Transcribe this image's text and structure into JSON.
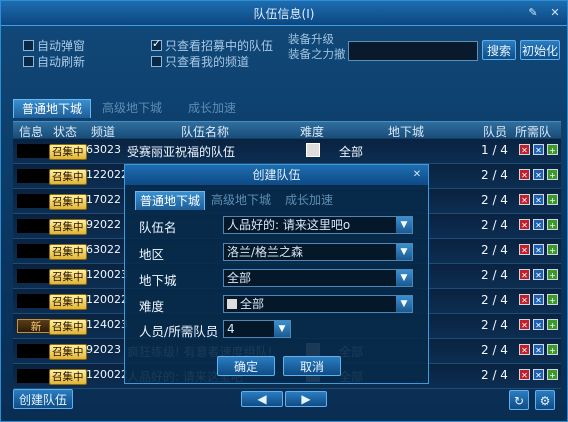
{
  "window": {
    "title": "队伍信息(I)"
  },
  "filters": {
    "auto_popup": "自动弹窗",
    "auto_refresh": "自动刷新",
    "only_recruiting": "只查看招募中的队伍",
    "only_my_channel": "只查看我的频道",
    "equip_upgrade": "装备升级",
    "equip_power": "装备之力撤",
    "search_value": "",
    "search_btn": "搜索",
    "reset_btn": "初始化"
  },
  "tabs": [
    "普通地下城",
    "高级地下城",
    "成长加速"
  ],
  "table": {
    "headers": {
      "info": "信息",
      "status": "状态",
      "channel": "频道",
      "team_name": "队伍名称",
      "difficulty": "难度",
      "dungeon": "地下城",
      "members": "队员",
      "needed": "所需队员"
    },
    "rows": [
      {
        "new": "",
        "status": "召集中",
        "channel": "63023",
        "name": "受赛丽亚祝福的队伍",
        "dungeon": "全部",
        "members": "1 / 4"
      },
      {
        "new": "",
        "status": "召集中",
        "channel": "122022",
        "name": "",
        "dungeon": "",
        "members": "2 / 4"
      },
      {
        "new": "",
        "status": "召集中",
        "channel": "17022",
        "name": "",
        "dungeon": "",
        "members": "2 / 4"
      },
      {
        "new": "",
        "status": "召集中",
        "channel": "92022",
        "name": "",
        "dungeon": "",
        "members": "2 / 4"
      },
      {
        "new": "",
        "status": "召集中",
        "channel": "63022",
        "name": "",
        "dungeon": "",
        "members": "2 / 4"
      },
      {
        "new": "",
        "status": "召集中",
        "channel": "120023",
        "name": "",
        "dungeon": "",
        "members": "2 / 4"
      },
      {
        "new": "",
        "status": "召集中",
        "channel": "120022",
        "name": "",
        "dungeon": "",
        "members": "2 / 4"
      },
      {
        "new": "新",
        "status": "召集中",
        "channel": "124023",
        "name": "",
        "dungeon": "",
        "members": "2 / 4"
      },
      {
        "new": "",
        "status": "召集中",
        "channel": "92023",
        "name": "疯狂练级! 有意者速度组队!",
        "dungeon": "全部",
        "members": "2 / 4"
      },
      {
        "new": "",
        "status": "召集中",
        "channel": "120022",
        "name": "人品好的: 请来这里吧",
        "dungeon": "全部",
        "members": "2 / 4"
      }
    ]
  },
  "dialog": {
    "title": "创建队伍",
    "tabs": [
      "普通地下城",
      "高级地下城",
      "成长加速"
    ],
    "team_name_label": "队伍名",
    "team_name_value": "人品好的: 请来这里吧o",
    "area_label": "地区",
    "area_value": "洛兰/格兰之森",
    "dungeon_label": "地下城",
    "dungeon_value": "全部",
    "difficulty_label": "难度",
    "difficulty_value": "全部",
    "members_label": "人员/所需队员",
    "members_value": "4",
    "ok": "确定",
    "cancel": "取消"
  },
  "footer": {
    "create_btn": "创建队伍"
  }
}
